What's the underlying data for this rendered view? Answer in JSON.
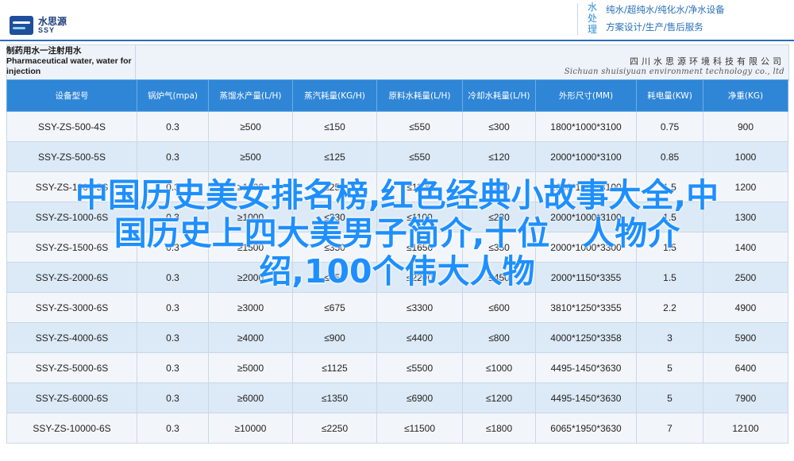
{
  "header": {
    "logo_cn": "水思源",
    "logo_en": "SSY",
    "service_vertical": [
      "水",
      "处",
      "理"
    ],
    "service_line1": "纯水/超纯水/纯化水/净水设备",
    "service_line2": "方案设计/生产/售后服务"
  },
  "title": {
    "product_cn": "制药用水一注射用水",
    "product_en": "Pharmaceutical water, water for injection",
    "company_cn": "四川水思源环境科技有限公司",
    "company_en": "Sichuan shuisiyuan environment technology co., ltd"
  },
  "table": {
    "headers": [
      "设备型号",
      "锅炉气(mpa)",
      "蒸馏水产量(L/H)",
      "蒸汽耗量(KG/H)",
      "原料水耗量(L/H)",
      "冷却水耗量(L/H)",
      "外形尺寸(MM)",
      "耗电量(KW)",
      "净重(KG)"
    ],
    "rows": [
      [
        "SSY-ZS-500-4S",
        "0.3",
        "≥500",
        "≤150",
        "≤550",
        "≤300",
        "1800*1000*3100",
        "0.75",
        "900"
      ],
      [
        "SSY-ZS-500-5S",
        "0.3",
        "≥500",
        "≤125",
        "≤550",
        "≤120",
        "2000*1000*3100",
        "0.85",
        "1000"
      ],
      [
        "SSY-ZS-1000-5S",
        "0.3",
        "≥1000",
        "≤250",
        "≤1100",
        "≤250",
        "2000*1000*3100",
        "1.5",
        "1200"
      ],
      [
        "SSY-ZS-1000-6S",
        "0.3",
        "≥1000",
        "≤230",
        "≤1100",
        "≤230",
        "2000*1000*3100",
        "1.5",
        "1300"
      ],
      [
        "SSY-ZS-1500-6S",
        "0.3",
        "≥1500",
        "≤350",
        "≤1650",
        "≤350",
        "2000*1000*3300",
        "1.5",
        "1400"
      ],
      [
        "SSY-ZS-2000-6S",
        "0.3",
        "≥2000",
        "≤450",
        "≤2200",
        "≤450",
        "2000*1150*3355",
        "1.5",
        "2500"
      ],
      [
        "SSY-ZS-3000-6S",
        "0.3",
        "≥3000",
        "≤675",
        "≤3300",
        "≤600",
        "3810*1250*3355",
        "2.2",
        "4900"
      ],
      [
        "SSY-ZS-4000-6S",
        "0.3",
        "≥4000",
        "≤900",
        "≤4400",
        "≤800",
        "4000*1250*3358",
        "3",
        "5900"
      ],
      [
        "SSY-ZS-5000-6S",
        "0.3",
        "≥5000",
        "≤1125",
        "≤5500",
        "≤1000",
        "4495-1450*3630",
        "5",
        "6400"
      ],
      [
        "SSY-ZS-6000-6S",
        "0.3",
        "≥6000",
        "≤1350",
        "≤6900",
        "≤1200",
        "4495-1450*3630",
        "5",
        "7900"
      ],
      [
        "SSY-ZS-10000-6S",
        "0.3",
        "≥10000",
        "≤2250",
        "≤11500",
        "≤1800",
        "6065*1950*3630",
        "7",
        "12100"
      ]
    ]
  },
  "overlay": {
    "line1": "中国历史美女排名榜,红色经典小故事大全,中",
    "line2": "国历史上四大美男子简介,十位　人物介",
    "line3": "绍,100个伟大人物"
  }
}
